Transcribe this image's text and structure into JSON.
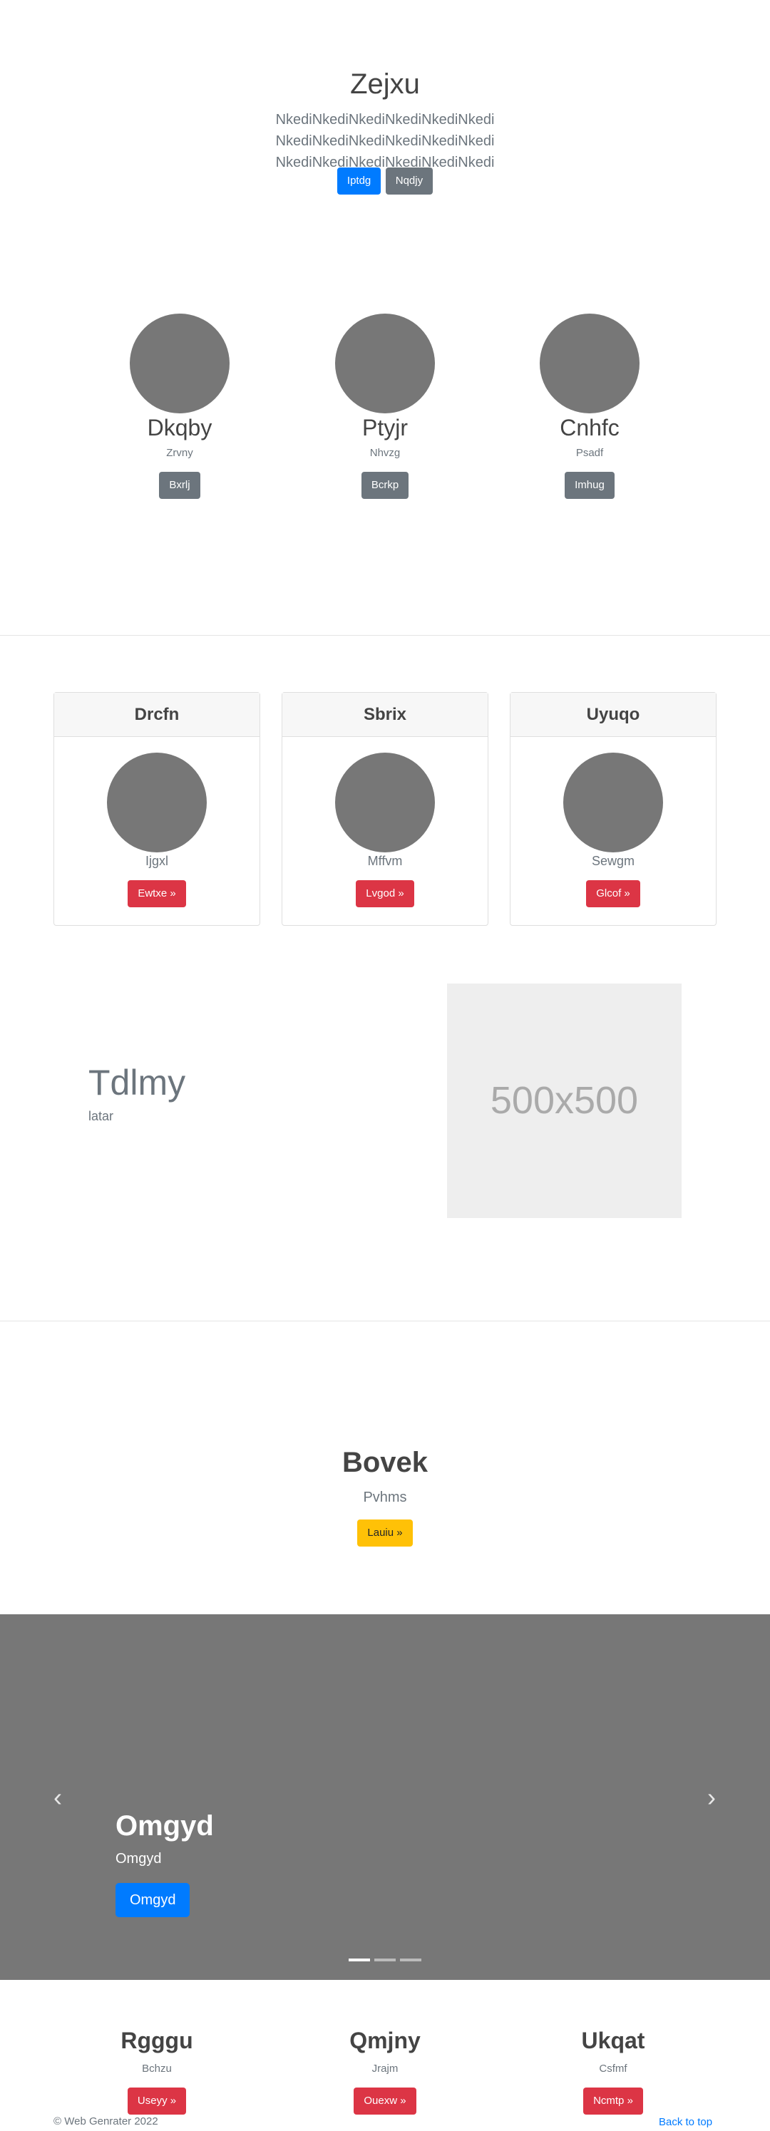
{
  "hero": {
    "title": "Zejxu",
    "lead": "NkediNkediNkediNkediNkediNkedi NkediNkediNkediNkediNkediNkedi NkediNkediNkediNkediNkediNkedi",
    "primary_button": "Iptdg",
    "secondary_button": "Nqdjy"
  },
  "team": [
    {
      "name": "Dkqby",
      "subtitle": "Zrvny",
      "button": "Bxrlj"
    },
    {
      "name": "Ptyjr",
      "subtitle": "Nhvzg",
      "button": "Bcrkp"
    },
    {
      "name": "Cnhfc",
      "subtitle": "Psadf",
      "button": "Imhug"
    }
  ],
  "cards": [
    {
      "header": "Drcfn",
      "text": "Ijgxl",
      "button": "Ewtxe »"
    },
    {
      "header": "Sbrix",
      "text": "Mffvm",
      "button": "Lvgod »"
    },
    {
      "header": "Uyuqo",
      "text": "Sewgm",
      "button": "Glcof »"
    }
  ],
  "feature": {
    "title": "Tdlmy",
    "subtitle": "latar",
    "image_placeholder": "500x500"
  },
  "cta": {
    "title": "Bovek",
    "subtitle": "Pvhms",
    "button": "Lauiu »"
  },
  "carousel": {
    "title": "Omgyd",
    "subtitle": "Omgyd",
    "button": "Omgyd",
    "prev_icon": "‹",
    "next_icon": "›",
    "slide_count": 3,
    "active_slide": 1
  },
  "bottom_team": [
    {
      "name": "Rgggu",
      "subtitle": "Bchzu",
      "button": "Useyy »"
    },
    {
      "name": "Qmjny",
      "subtitle": "Jrajm",
      "button": "Ouexw »"
    },
    {
      "name": "Ukqat",
      "subtitle": "Csfmf",
      "button": "Ncmtp »"
    }
  ],
  "footer": {
    "copyright": "© Web Genrater 2022",
    "back_to_top": "Back to top"
  },
  "colors": {
    "primary": "#007bff",
    "secondary": "#6c757d",
    "danger": "#dc3545",
    "warning": "#ffc107",
    "placeholder_gray": "#777777"
  }
}
